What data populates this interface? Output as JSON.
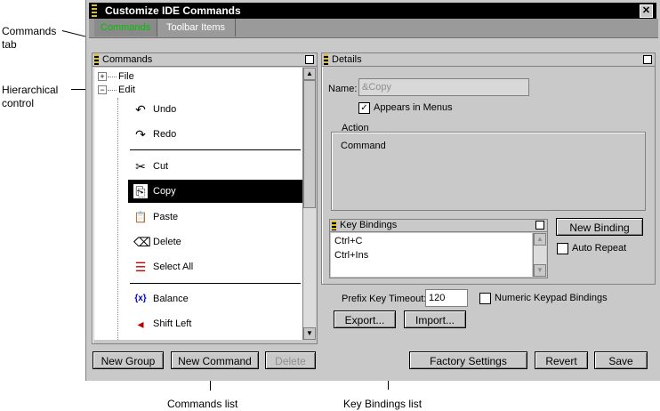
{
  "callouts": {
    "commands_tab": "Commands\ntab",
    "hierarchical": "Hierarchical\ncontrol",
    "commands_list": "Commands list",
    "key_bindings_list": "Key Bindings list"
  },
  "window": {
    "title": "Customize IDE Commands",
    "close_glyph": "✕"
  },
  "tabs": {
    "commands": "Commands",
    "toolbar_items": "Toolbar Items"
  },
  "commands_panel": {
    "title": "Commands",
    "tree": {
      "file": {
        "label": "File",
        "toggle": "+"
      },
      "edit": {
        "label": "Edit",
        "toggle": "−"
      }
    },
    "items": [
      {
        "label": "Undo",
        "icon": "↶"
      },
      {
        "label": "Redo",
        "icon": "↷"
      },
      {
        "label": "Cut",
        "icon": "✂"
      },
      {
        "label": "Copy",
        "icon": "⎘"
      },
      {
        "label": "Paste",
        "icon": "📋"
      },
      {
        "label": "Delete",
        "icon": "⌫"
      },
      {
        "label": "Select All",
        "icon": "☰"
      },
      {
        "label": "Balance",
        "icon": "{x}"
      },
      {
        "label": "Shift Left",
        "icon": "◂"
      }
    ],
    "selected": "Copy",
    "buttons": {
      "new_group": "New Group",
      "new_command": "New Command",
      "delete": "Delete"
    }
  },
  "details_panel": {
    "title": "Details",
    "name_label": "Name:",
    "name_value": "&Copy",
    "appears_in_menus": {
      "label": "Appears in Menus",
      "checked": "✓"
    },
    "action_label": "Action",
    "action_value": "Command",
    "key_bindings": {
      "title": "Key Bindings",
      "items": [
        "Ctrl+C",
        "Ctrl+Ins"
      ]
    },
    "new_binding": "New Binding",
    "auto_repeat": "Auto Repeat",
    "prefix_label": "Prefix Key Timeout:",
    "prefix_value": "120",
    "numeric_keypad": "Numeric Keypad Bindings",
    "export": "Export...",
    "import": "Import..."
  },
  "bottom_buttons": {
    "factory": "Factory Settings",
    "revert": "Revert",
    "save": "Save"
  },
  "colors": {
    "active_tab_text": "#00c000",
    "selection": "#000000",
    "window_bg": "#c9c9c9"
  }
}
